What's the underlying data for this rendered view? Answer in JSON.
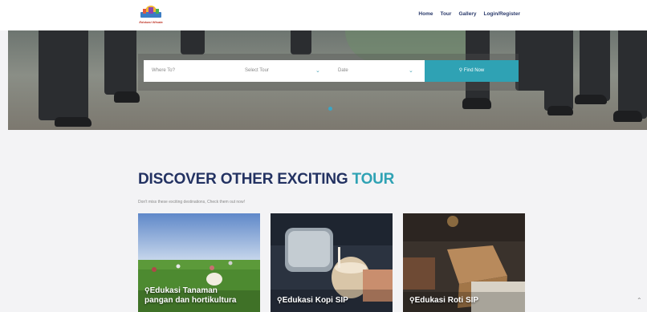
{
  "header": {
    "logo_text": "Edukasi Wisata",
    "nav": [
      "Home",
      "Tour",
      "Gallery",
      "Login/Register"
    ]
  },
  "search": {
    "where_placeholder": "Where To?",
    "tour_placeholder": "Select Tour",
    "date_placeholder": "Date",
    "find_label": "Find Now"
  },
  "discover": {
    "title_main": "DISCOVER OTHER EXCITING ",
    "title_accent": "TOUR",
    "subtitle": "Don't miss these exciting destinations, Check them out now!"
  },
  "cards": [
    {
      "label_line1": "Edukasi Tanaman",
      "label_line2": "pangan dan hortikultura"
    },
    {
      "label_line1": "Edukasi Kopi SIP",
      "label_line2": ""
    },
    {
      "label_line1": "Edukasi Roti SIP",
      "label_line2": ""
    }
  ],
  "colors": {
    "accent": "#2fa2b4",
    "navy": "#233262"
  }
}
